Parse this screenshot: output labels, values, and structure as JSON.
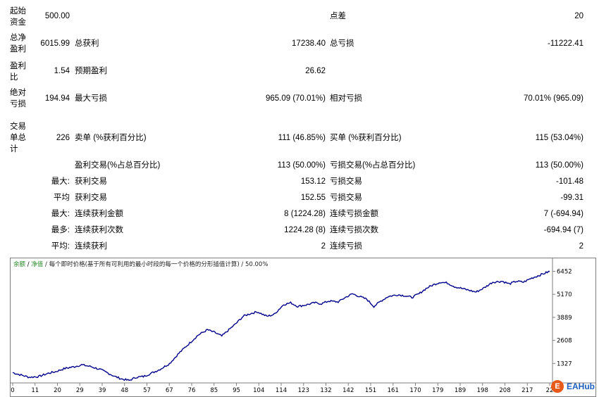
{
  "stats": {
    "initial_deposit": {
      "label": "起始资金",
      "value": "500.00"
    },
    "spread": {
      "label": "点差",
      "value": "20"
    },
    "total_net_profit": {
      "label": "总净盈利",
      "value": "6015.99"
    },
    "gross_profit": {
      "label": "总获利",
      "value": "17238.40"
    },
    "gross_loss": {
      "label": "总亏损",
      "value": "-11222.41"
    },
    "profit_factor": {
      "label": "盈利比",
      "value": "1.54"
    },
    "expected_payoff": {
      "label": "预期盈利",
      "value": "26.62"
    },
    "absolute_drawdown": {
      "label": "绝对亏损",
      "value": "194.94"
    },
    "maximal_drawdown": {
      "label": "最大亏损",
      "value": "965.09 (70.01%)"
    },
    "relative_drawdown": {
      "label": "相对亏损",
      "value": "70.01% (965.09)"
    },
    "total_trades": {
      "label": "交易单总计",
      "value": "226"
    },
    "short_positions": {
      "label": "卖单 (%获利百分比)",
      "value": "111 (46.85%)"
    },
    "long_positions": {
      "label": "买单 (%获利百分比)",
      "value": "115 (53.04%)"
    },
    "profit_trades": {
      "label": "盈利交易(%占总百分比)",
      "value": "113 (50.00%)"
    },
    "loss_trades": {
      "label": "亏损交易(%占总百分比)",
      "value": "113 (50.00%)"
    },
    "largest_row": {
      "prefix": "最大:",
      "profit_label": "获利交易",
      "profit_value": "153.12",
      "loss_label": "亏损交易",
      "loss_value": "-101.48"
    },
    "average_row": {
      "prefix": "平均",
      "profit_label": "获利交易",
      "profit_value": "152.55",
      "loss_label": "亏损交易",
      "loss_value": "-99.31"
    },
    "max_consec_row": {
      "prefix": "最大:",
      "profit_label": "连续获利金额",
      "profit_value": "8 (1224.28)",
      "loss_label": "连续亏损金额",
      "loss_value": "7 (-694.94)"
    },
    "max_consec_amount_row": {
      "prefix": "最多:",
      "profit_label": "连续获利次数",
      "profit_value": "1224.28 (8)",
      "loss_label": "连续亏损次数",
      "loss_value": "-694.94 (7)"
    },
    "avg_consec_row": {
      "prefix": "平均:",
      "profit_label": "连续获利",
      "profit_value": "2",
      "loss_label": "连续亏损",
      "loss_value": "2"
    }
  },
  "chart_header": {
    "balance": "余额",
    "sep1": " / ",
    "equity": "净值",
    "sep2": " / ",
    "rest": "每个即时价格(基于所有可利用的最小时段的每一个价格的分形插值计算) / 50.00%",
    "balance_color": "#2a8a2a",
    "equity_color": "#2a8a2a"
  },
  "logo": {
    "mark": "E",
    "text": "EAHub"
  },
  "chart_data": {
    "type": "line",
    "x_ticks": [
      "0",
      "11",
      "20",
      "29",
      "39",
      "48",
      "57",
      "67",
      "76",
      "85",
      "95",
      "104",
      "114",
      "123",
      "132",
      "142",
      "151",
      "161",
      "170",
      "179",
      "189",
      "198",
      "208",
      "217",
      "22"
    ],
    "y_ticks": [
      "6452",
      "5170",
      "3889",
      "2608",
      "1327"
    ],
    "xlim": [
      0,
      226
    ],
    "ylim": [
      400,
      6900
    ],
    "line_color": "#00008b",
    "anchors": [
      [
        0,
        820
      ],
      [
        3,
        700
      ],
      [
        7,
        560
      ],
      [
        11,
        600
      ],
      [
        15,
        780
      ],
      [
        18,
        870
      ],
      [
        22,
        1050
      ],
      [
        26,
        1150
      ],
      [
        29,
        1250
      ],
      [
        33,
        1150
      ],
      [
        37,
        980
      ],
      [
        40,
        800
      ],
      [
        43,
        600
      ],
      [
        46,
        460
      ],
      [
        49,
        380
      ],
      [
        52,
        560
      ],
      [
        55,
        600
      ],
      [
        58,
        760
      ],
      [
        62,
        1000
      ],
      [
        66,
        1320
      ],
      [
        70,
        1900
      ],
      [
        74,
        2400
      ],
      [
        78,
        2900
      ],
      [
        82,
        3200
      ],
      [
        85,
        3050
      ],
      [
        88,
        2850
      ],
      [
        91,
        3200
      ],
      [
        94,
        3550
      ],
      [
        97,
        3950
      ],
      [
        100,
        4100
      ],
      [
        103,
        4200
      ],
      [
        107,
        3950
      ],
      [
        110,
        4050
      ],
      [
        114,
        4600
      ],
      [
        117,
        4700
      ],
      [
        120,
        4500
      ],
      [
        124,
        4600
      ],
      [
        127,
        4700
      ],
      [
        130,
        4650
      ],
      [
        133,
        4800
      ],
      [
        137,
        4750
      ],
      [
        140,
        5000
      ],
      [
        143,
        5200
      ],
      [
        146,
        5050
      ],
      [
        149,
        4900
      ],
      [
        152,
        4500
      ],
      [
        155,
        4800
      ],
      [
        158,
        5050
      ],
      [
        162,
        5150
      ],
      [
        165,
        5100
      ],
      [
        168,
        5000
      ],
      [
        171,
        5200
      ],
      [
        174,
        5500
      ],
      [
        177,
        5700
      ],
      [
        180,
        5850
      ],
      [
        183,
        5800
      ],
      [
        186,
        5600
      ],
      [
        189,
        5500
      ],
      [
        192,
        5400
      ],
      [
        195,
        5300
      ],
      [
        198,
        5500
      ],
      [
        202,
        5850
      ],
      [
        206,
        5900
      ],
      [
        209,
        5750
      ],
      [
        212,
        5900
      ],
      [
        215,
        5850
      ],
      [
        218,
        6050
      ],
      [
        221,
        6200
      ],
      [
        224,
        6350
      ],
      [
        226,
        6450
      ]
    ]
  }
}
